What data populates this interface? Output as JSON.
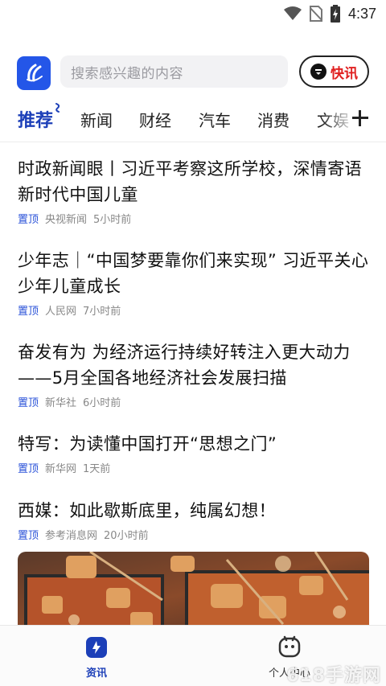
{
  "status_bar": {
    "time": "4:37"
  },
  "header": {
    "search_placeholder": "搜索感兴趣的内容",
    "kuaixun_label": "快讯"
  },
  "tabs": [
    {
      "label": "推荐",
      "active": true
    },
    {
      "label": "新闻",
      "active": false
    },
    {
      "label": "财经",
      "active": false
    },
    {
      "label": "汽车",
      "active": false
    },
    {
      "label": "消费",
      "active": false
    },
    {
      "label": "文娱",
      "active": false
    }
  ],
  "feed": [
    {
      "title": "时政新闻眼丨习近平考察这所学校，深情寄语新时代中国儿童",
      "pin": "置顶",
      "source": "央视新闻",
      "time": "5小时前"
    },
    {
      "title": "少年志｜“中国梦要靠你们来实现” 习近平关心少年儿童成长",
      "pin": "置顶",
      "source": "人民网",
      "time": "7小时前"
    },
    {
      "title": "奋发有为 为经济运行持续好转注入更大动力——5月全国各地经济社会发展扫描",
      "pin": "置顶",
      "source": "新华社",
      "time": "6小时前"
    },
    {
      "title": "特写：为读懂中国打开“思想之门”",
      "pin": "置顶",
      "source": "新华网",
      "time": "1天前"
    },
    {
      "title": "西媒：如此歇斯底里，纯属幻想！",
      "pin": "置顶",
      "source": "参考消息网",
      "time": "20小时前"
    }
  ],
  "bottom_nav": [
    {
      "label": "资讯",
      "icon": "news-icon",
      "active": true
    },
    {
      "label": "个人中心",
      "icon": "profile-icon",
      "active": false
    }
  ],
  "watermark": "618手游网",
  "colors": {
    "accent": "#1c3fb8",
    "logo": "#2456e8",
    "kuaixun": "#e02020"
  }
}
